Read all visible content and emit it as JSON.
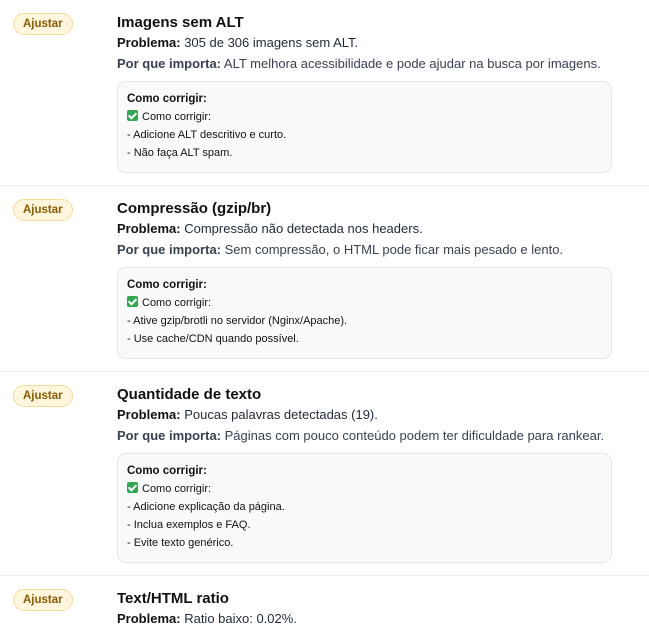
{
  "issues": [
    {
      "badge": "Ajustar",
      "title": "Imagens sem ALT",
      "problem_label": "Problema:",
      "problem_text": "305 de 306 imagens sem ALT.",
      "why_label": "Por que importa:",
      "why_text": "ALT melhora acessibilidade e pode ajudar na busca por imagens.",
      "fix_heading": "Como corrigir:",
      "fix_intro": "Como corrigir:",
      "fix_steps": [
        "- Adicione ALT descritivo e curto.",
        "- Não faça ALT spam."
      ]
    },
    {
      "badge": "Ajustar",
      "title": "Compressão (gzip/br)",
      "problem_label": "Problema:",
      "problem_text": "Compressão não detectada nos headers.",
      "why_label": "Por que importa:",
      "why_text": "Sem compressão, o HTML pode ficar mais pesado e lento.",
      "fix_heading": "Como corrigir:",
      "fix_intro": "Como corrigir:",
      "fix_steps": [
        "- Ative gzip/brotli no servidor (Nginx/Apache).",
        "- Use cache/CDN quando possível."
      ]
    },
    {
      "badge": "Ajustar",
      "title": "Quantidade de texto",
      "problem_label": "Problema:",
      "problem_text": "Poucas palavras detectadas (19).",
      "why_label": "Por que importa:",
      "why_text": "Páginas com pouco conteúdo podem ter dificuldade para rankear.",
      "fix_heading": "Como corrigir:",
      "fix_intro": "Como corrigir:",
      "fix_steps": [
        "- Adicione explicação da página.",
        "- Inclua exemplos e FAQ.",
        "- Evite texto genérico."
      ]
    },
    {
      "badge": "Ajustar",
      "title": "Text/HTML ratio",
      "problem_label": "Problema:",
      "problem_text": "Ratio baixo: 0.02%."
    }
  ],
  "colors": {
    "badge_bg": "#fff6dd",
    "badge_text": "#8a5a00",
    "check_green": "#2fa84f"
  },
  "icons": {
    "check": "check-mark-icon"
  }
}
